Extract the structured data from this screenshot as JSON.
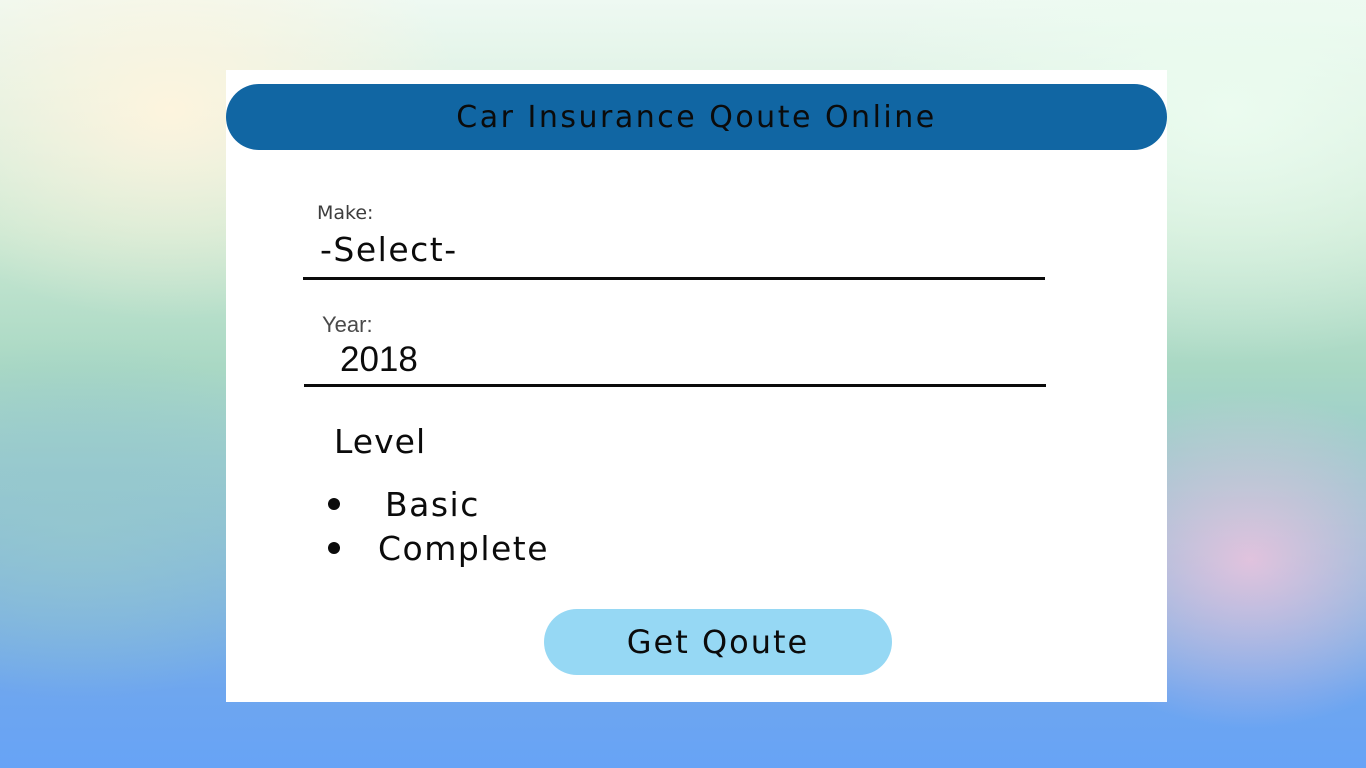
{
  "header": {
    "title": "Car Insurance Qoute Online"
  },
  "form": {
    "make": {
      "label": "Make:",
      "value": "-Select-"
    },
    "year": {
      "label": "Year:",
      "value": "2018"
    },
    "level": {
      "label": "Level",
      "options": [
        {
          "label": "Basic"
        },
        {
          "label": "Complete"
        }
      ]
    },
    "submit_label": "Get Qoute"
  },
  "colors": {
    "header_bar": "#1166a3",
    "button": "#96d8f4",
    "card": "#ffffff",
    "text": "#0b0b0b"
  }
}
